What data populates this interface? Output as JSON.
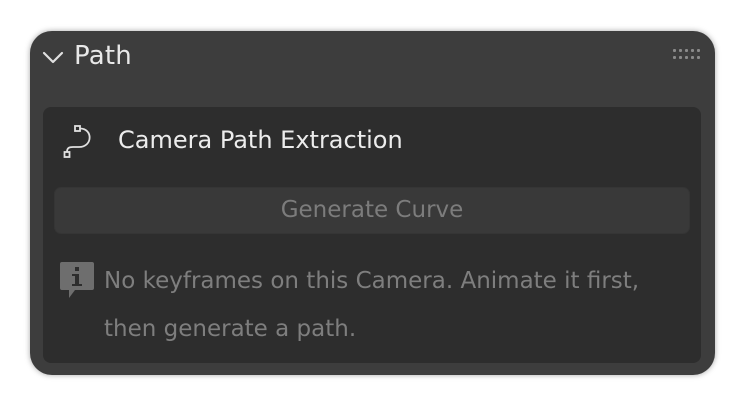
{
  "panel": {
    "title": "Path",
    "collapse_icon": "chevron-down-icon",
    "drag_icon": "drag-handle-icon"
  },
  "subpanel": {
    "icon": "curve-path-icon",
    "title": "Camera Path Extraction",
    "button_label": "Generate Curve",
    "button_enabled": false,
    "info_icon": "info-icon",
    "info_line1": "No keyframes on this Camera. Animate it first,",
    "info_line2": "then generate a path."
  },
  "colors": {
    "panel_bg": "#3d3d3d",
    "subpanel_bg": "#2d2d2d",
    "button_bg": "#393939",
    "text_primary": "#e8e8e8",
    "text_muted": "#7e7e7e"
  }
}
